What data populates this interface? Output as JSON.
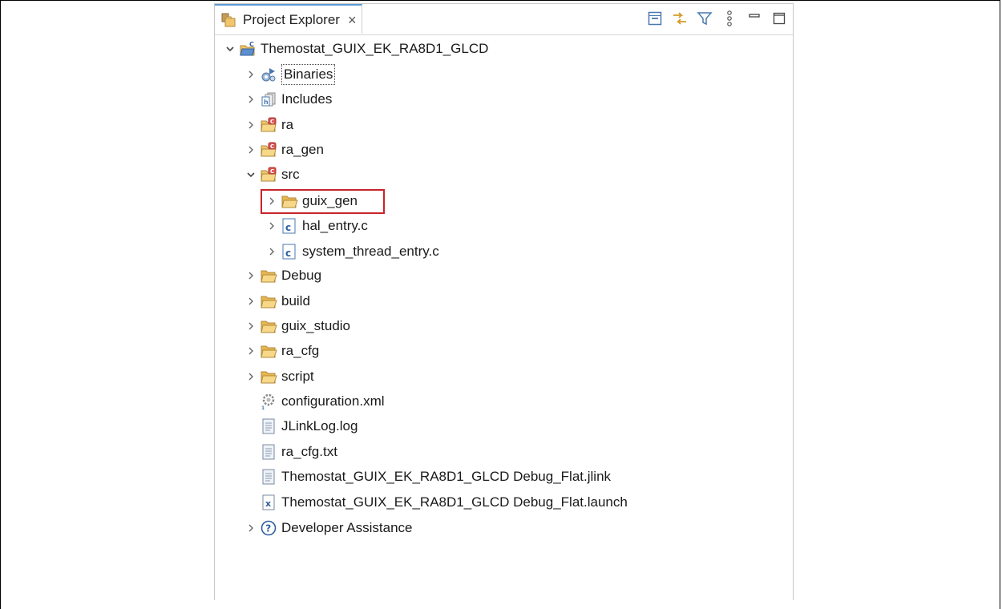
{
  "view": {
    "tab_label": "Project Explorer",
    "tab_close": "×",
    "toolbar": [
      "collapse-all-icon",
      "link-with-editor-icon",
      "filter-icon",
      "view-menu-icon",
      "minimize-icon",
      "maximize-icon"
    ]
  },
  "tree": {
    "project": "Themostat_GUIX_EK_RA8D1_GLCD",
    "items": [
      {
        "label": "Binaries",
        "icon": "binaries-icon"
      },
      {
        "label": "Includes",
        "icon": "includes-icon"
      },
      {
        "label": "ra",
        "icon": "source-folder-icon"
      },
      {
        "label": "ra_gen",
        "icon": "source-folder-icon"
      },
      {
        "label": "src",
        "icon": "source-folder-icon"
      },
      {
        "label": "guix_gen",
        "icon": "folder-icon"
      },
      {
        "label": "hal_entry.c",
        "icon": "c-file-icon"
      },
      {
        "label": "system_thread_entry.c",
        "icon": "c-file-icon"
      },
      {
        "label": "Debug",
        "icon": "folder-icon"
      },
      {
        "label": "build",
        "icon": "folder-icon"
      },
      {
        "label": "guix_studio",
        "icon": "folder-icon"
      },
      {
        "label": "ra_cfg",
        "icon": "folder-icon"
      },
      {
        "label": "script",
        "icon": "folder-icon"
      },
      {
        "label": "configuration.xml",
        "icon": "config-gear-icon"
      },
      {
        "label": "JLinkLog.log",
        "icon": "text-file-icon"
      },
      {
        "label": "ra_cfg.txt",
        "icon": "text-file-icon"
      },
      {
        "label": "Themostat_GUIX_EK_RA8D1_GLCD Debug_Flat.jlink",
        "icon": "text-file-icon"
      },
      {
        "label": "Themostat_GUIX_EK_RA8D1_GLCD Debug_Flat.launch",
        "icon": "launch-file-icon"
      },
      {
        "label": "Developer Assistance",
        "icon": "help-icon"
      }
    ]
  },
  "colors": {
    "highlight": "#c8242b",
    "folder": "#f2c66d",
    "source_folder_badge": "#d9534f",
    "tab_accent": "#5b9bd5"
  }
}
